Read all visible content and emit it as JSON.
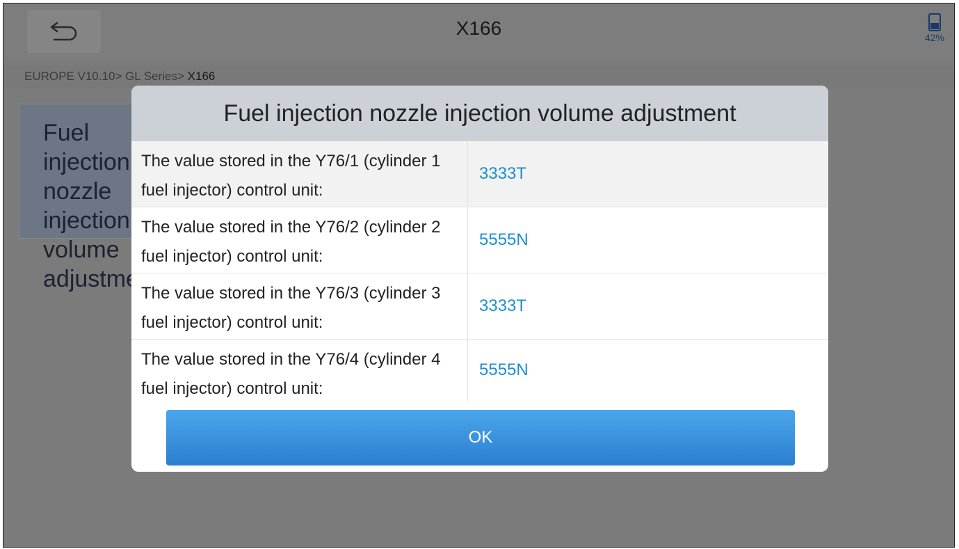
{
  "header": {
    "title": "X166",
    "battery_percent": "42%"
  },
  "breadcrumb": {
    "path": "EUROPE V10.10> GL Series> ",
    "current": "X166"
  },
  "background_card": {
    "label": "Fuel injection nozzle injection volume adjustment"
  },
  "dialog": {
    "title": "Fuel injection nozzle injection volume adjustment",
    "rows": [
      {
        "label": "The value stored in the Y76/1 (cylinder 1 fuel injector) control unit:",
        "value": "3333T"
      },
      {
        "label": "The value stored in the Y76/2 (cylinder 2 fuel injector) control unit:",
        "value": "5555N"
      },
      {
        "label": "The value stored in the Y76/3 (cylinder 3 fuel injector) control unit:",
        "value": "3333T"
      },
      {
        "label": "The value stored in the Y76/4 (cylinder 4 fuel injector) control unit:",
        "value": "5555N"
      }
    ],
    "ok_label": "OK"
  },
  "colors": {
    "accent": "#1a8fd4",
    "button": "#2b7fd0",
    "overlay": "#7b7b7b"
  },
  "icons": {
    "back": "back-arrow-icon",
    "battery": "battery-icon"
  }
}
